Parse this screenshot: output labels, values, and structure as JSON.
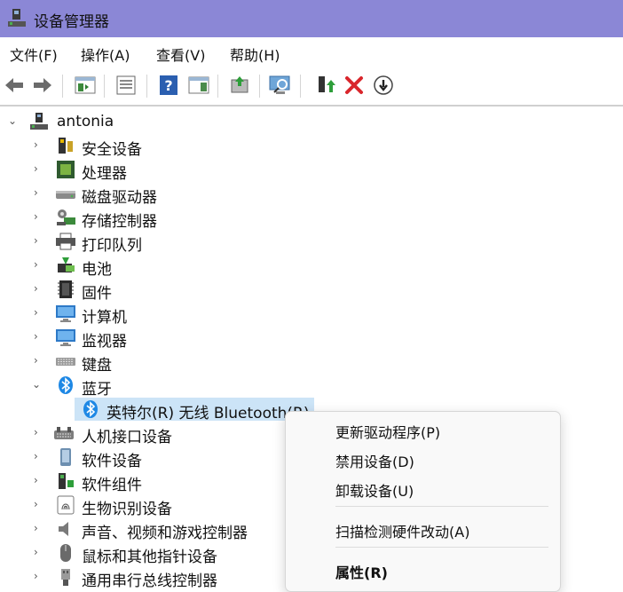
{
  "window": {
    "title": "设备管理器"
  },
  "menu": [
    "文件(F)",
    "操作(A)",
    "查看(V)",
    "帮助(H)"
  ],
  "toolbar": {
    "buttons": [
      "back-icon",
      "forward-icon",
      "show-hide-tree-icon",
      "properties-icon",
      "help-icon",
      "action-pane-icon",
      "update-driver-icon",
      "scan-hardware-icon",
      "enable-device-icon",
      "uninstall-icon",
      "disable-device-icon"
    ]
  },
  "tree": {
    "root": "antonia",
    "items": [
      "安全设备",
      "处理器",
      "磁盘驱动器",
      "存储控制器",
      "打印队列",
      "电池",
      "固件",
      "计算机",
      "监视器",
      "键盘",
      "蓝牙",
      "英特尔(R) 无线 Bluetooth(R)",
      "人机接口设备",
      "软件设备",
      "软件组件",
      "生物识别设备",
      "声音、视频和游戏控制器",
      "鼠标和其他指针设备",
      "通用串行总线控制器"
    ]
  },
  "context_menu": {
    "items": [
      "更新驱动程序(P)",
      "禁用设备(D)",
      "卸载设备(U)",
      "扫描检测硬件改动(A)",
      "属性(R)"
    ]
  },
  "colors": {
    "titlebar": "#8b87d6",
    "selection": "#cce4f7",
    "bluetooth": "#1e88e5",
    "error": "#d9262c"
  }
}
